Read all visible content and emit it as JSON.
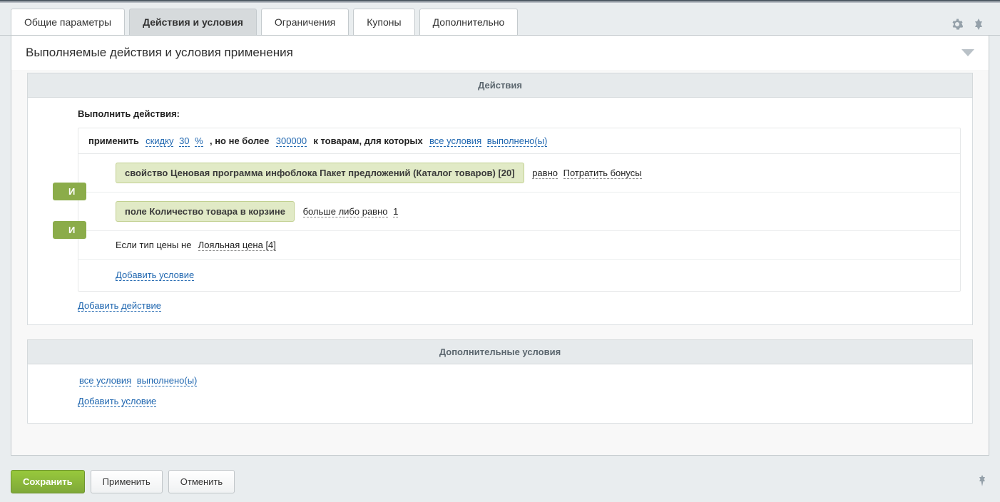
{
  "tabs": {
    "general": "Общие параметры",
    "actions": "Действия и условия",
    "limits": "Ограничения",
    "coupons": "Купоны",
    "extra": "Дополнительно"
  },
  "panel": {
    "title": "Выполняемые действия и условия применения"
  },
  "sections": {
    "actions": {
      "head": "Действия",
      "execute_label": "Выполнить действия:",
      "rule": {
        "apply": "применить",
        "discount": "скидку",
        "amount": "30",
        "unit": "%",
        "but_not_more": ", но не более",
        "limit": "300000",
        "to_goods": "к товарам, для которых",
        "all_cond": "все условия",
        "fulfilled": "выполнено(ы)"
      },
      "cond1": {
        "chip": "свойство Ценовая программа инфоблока Пакет предложений (Каталог товаров) [20]",
        "op": "равно",
        "val": "Потратить бонусы"
      },
      "cond2": {
        "chip": "поле Количество товара в корзине",
        "op": "больше либо равно",
        "val": "1"
      },
      "cond3": {
        "pre": "Если тип цены не",
        "val": "Лояльная цена [4]"
      },
      "conj": "И",
      "add_condition": "Добавить условие",
      "add_action": "Добавить действие"
    },
    "extra": {
      "head": "Дополнительные условия",
      "all_cond": "все условия",
      "fulfilled": "выполнено(ы)",
      "add_condition": "Добавить условие"
    }
  },
  "footer": {
    "save": "Сохранить",
    "apply": "Применить",
    "cancel": "Отменить"
  }
}
